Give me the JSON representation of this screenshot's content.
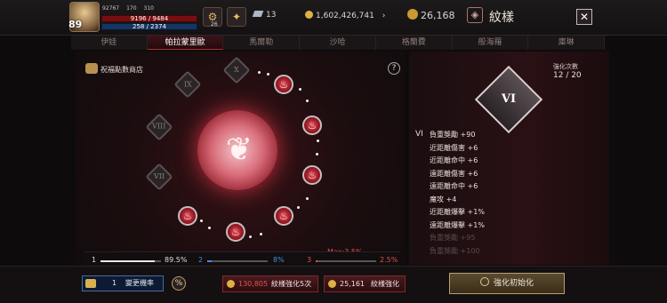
{
  "header": {
    "level": "89",
    "stats": [
      "92767",
      "170",
      "310"
    ],
    "hp": "9196 / 9484",
    "mp": "258 / 2374",
    "buff_icon_label": "26",
    "gems": "13",
    "gold": "1,602,426,741",
    "currency": "26,168",
    "title": "紋樣",
    "close_label": "✕"
  },
  "tabs": [
    "伊娃",
    "帕拉蒙里歐",
    "馬爾勒",
    "沙哈",
    "格蘭費",
    "般海羅",
    "庫琳"
  ],
  "active_tab": 1,
  "shop_label": "祝福點數商店",
  "help_label": "?",
  "locked_nodes": [
    "X",
    "IX",
    "VIII",
    "VII"
  ],
  "emblem_label": "VI",
  "enhance": {
    "label": "強化次數",
    "value": "12 / 20"
  },
  "tier": "VI",
  "effects": [
    {
      "text": "負重獎勵 +90",
      "fade": false
    },
    {
      "text": "近距離傷害 +6",
      "fade": false
    },
    {
      "text": "近距離命中 +6",
      "fade": false
    },
    {
      "text": "遠距離傷害 +6",
      "fade": false
    },
    {
      "text": "遠距離命中 +6",
      "fade": false
    },
    {
      "text": "魔攻 +4",
      "fade": false
    },
    {
      "text": "近距離爆擊 +1%",
      "fade": false
    },
    {
      "text": "遠距離爆擊 +1%",
      "fade": false
    },
    {
      "text": "負重獎勵 +95",
      "fade": true
    },
    {
      "text": "負重獎勵 +100",
      "fade": true
    }
  ],
  "rates": [
    {
      "label": "1",
      "value": "89.5%",
      "color": "#e8e8e8",
      "fill": 0.895
    },
    {
      "label": "2",
      "value": "8%",
      "color": "#4a8ae0",
      "fill": 0.08
    },
    {
      "label": "3",
      "value": "2.5%",
      "color": "#e05050",
      "fill": 0.025
    }
  ],
  "max_rate": "Max:3.5%",
  "bottom": {
    "rate_count": "1",
    "rate_label": "變更機率",
    "pct_label": "%",
    "enhance5_price": "130,805",
    "enhance5_label": "紋樣強化5次",
    "enhance_price": "25,161",
    "enhance_label": "紋樣強化",
    "reset_label": "強化初始化"
  },
  "colors": {
    "accent": "#c0303f",
    "gold": "#e0b040"
  }
}
